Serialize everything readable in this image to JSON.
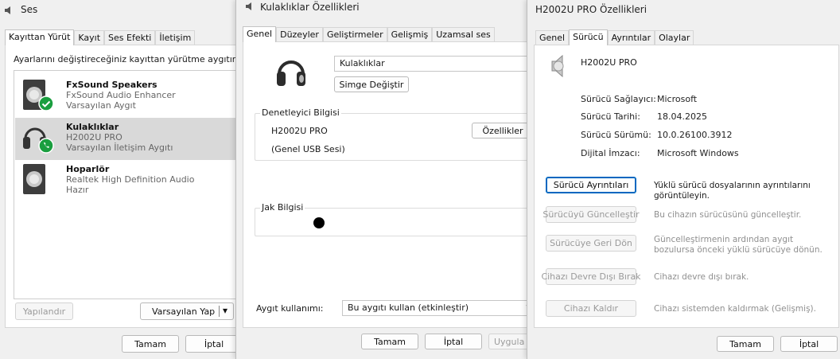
{
  "ses": {
    "title": "Ses",
    "tabs": [
      "Kayıttan Yürüt",
      "Kayıt",
      "Ses Efekti",
      "İletişim"
    ],
    "instruction": "Ayarlarını değiştireceğiniz kayıttan yürütme aygıtını aşa",
    "devices": [
      {
        "name": "FxSound Speakers",
        "sub": "FxSound Audio Enhancer",
        "status": "Varsayılan Aygıt",
        "badge": "check-icon"
      },
      {
        "name": "Kulaklıklar",
        "sub": "H2002U PRO",
        "status": "Varsayılan İletişim Aygıtı",
        "badge": "phone-icon"
      },
      {
        "name": "Hoparlör",
        "sub": "Realtek High Definition Audio",
        "status": "Hazır",
        "badge": ""
      }
    ],
    "configure_label": "Yapılandır",
    "set_default_label": "Varsayılan Yap",
    "dropdown_arrow": "▾",
    "ok_label": "Tamam",
    "cancel_label": "İptal"
  },
  "kulaklik": {
    "title": "Kulaklıklar Özellikleri",
    "tabs": [
      "Genel",
      "Düzeyler",
      "Geliştirmeler",
      "Gelişmiş",
      "Uzamsal ses"
    ],
    "device_name": "Kulaklıklar",
    "change_icon_label": "Simge Değiştir",
    "controller_group": "Denetleyici Bilgisi",
    "controller_name": "H2002U PRO",
    "controller_sub": "(Genel USB Sesi)",
    "properties_label": "Özellikler",
    "jack_group": "Jak Bilgisi",
    "usage_label": "Aygıt kullanımı:",
    "usage_value": "Bu aygıtı kullan (etkinleştir)",
    "ok_label": "Tamam",
    "cancel_label": "İptal",
    "apply_label": "Uygula"
  },
  "h2002u": {
    "title": "H2002U PRO Özellikleri",
    "tabs": [
      "Genel",
      "Sürücü",
      "Ayrıntılar",
      "Olaylar"
    ],
    "device_name": "H2002U PRO",
    "info": [
      {
        "label": "Sürücü Sağlayıcı:",
        "value": "Microsoft"
      },
      {
        "label": "Sürücü Tarihi:",
        "value": "18.04.2025"
      },
      {
        "label": "Sürücü Sürümü:",
        "value": "10.0.26100.3912"
      },
      {
        "label": "Dijital İmzacı:",
        "value": "Microsoft Windows"
      }
    ],
    "actions": [
      {
        "label": "Sürücü Ayrıntıları",
        "desc": "Yüklü sürücü dosyalarının ayrıntılarını görüntüleyin.",
        "enabled": true
      },
      {
        "label": "Sürücüyü Güncelleştir",
        "desc": "Bu cihazın sürücüsünü güncelleştir.",
        "enabled": false
      },
      {
        "label": "Sürücüye Geri Dön",
        "desc": "Güncelleştirmenin ardından aygıt bozulursa önceki yüklü sürücüye dönün.",
        "enabled": false
      },
      {
        "label": "Cihazı Devre Dışı Bırak",
        "desc": "Cihazı devre dışı bırak.",
        "enabled": false
      },
      {
        "label": "Cihazı Kaldır",
        "desc": "Cihazı sistemden kaldırmak (Gelişmiş).",
        "enabled": false
      }
    ],
    "ok_label": "Tamam",
    "cancel_label": "İptal"
  },
  "colors": {
    "accent": "#0067c0",
    "check_badge": "#1a9e3f",
    "selected_row": "#d9d9d9"
  }
}
